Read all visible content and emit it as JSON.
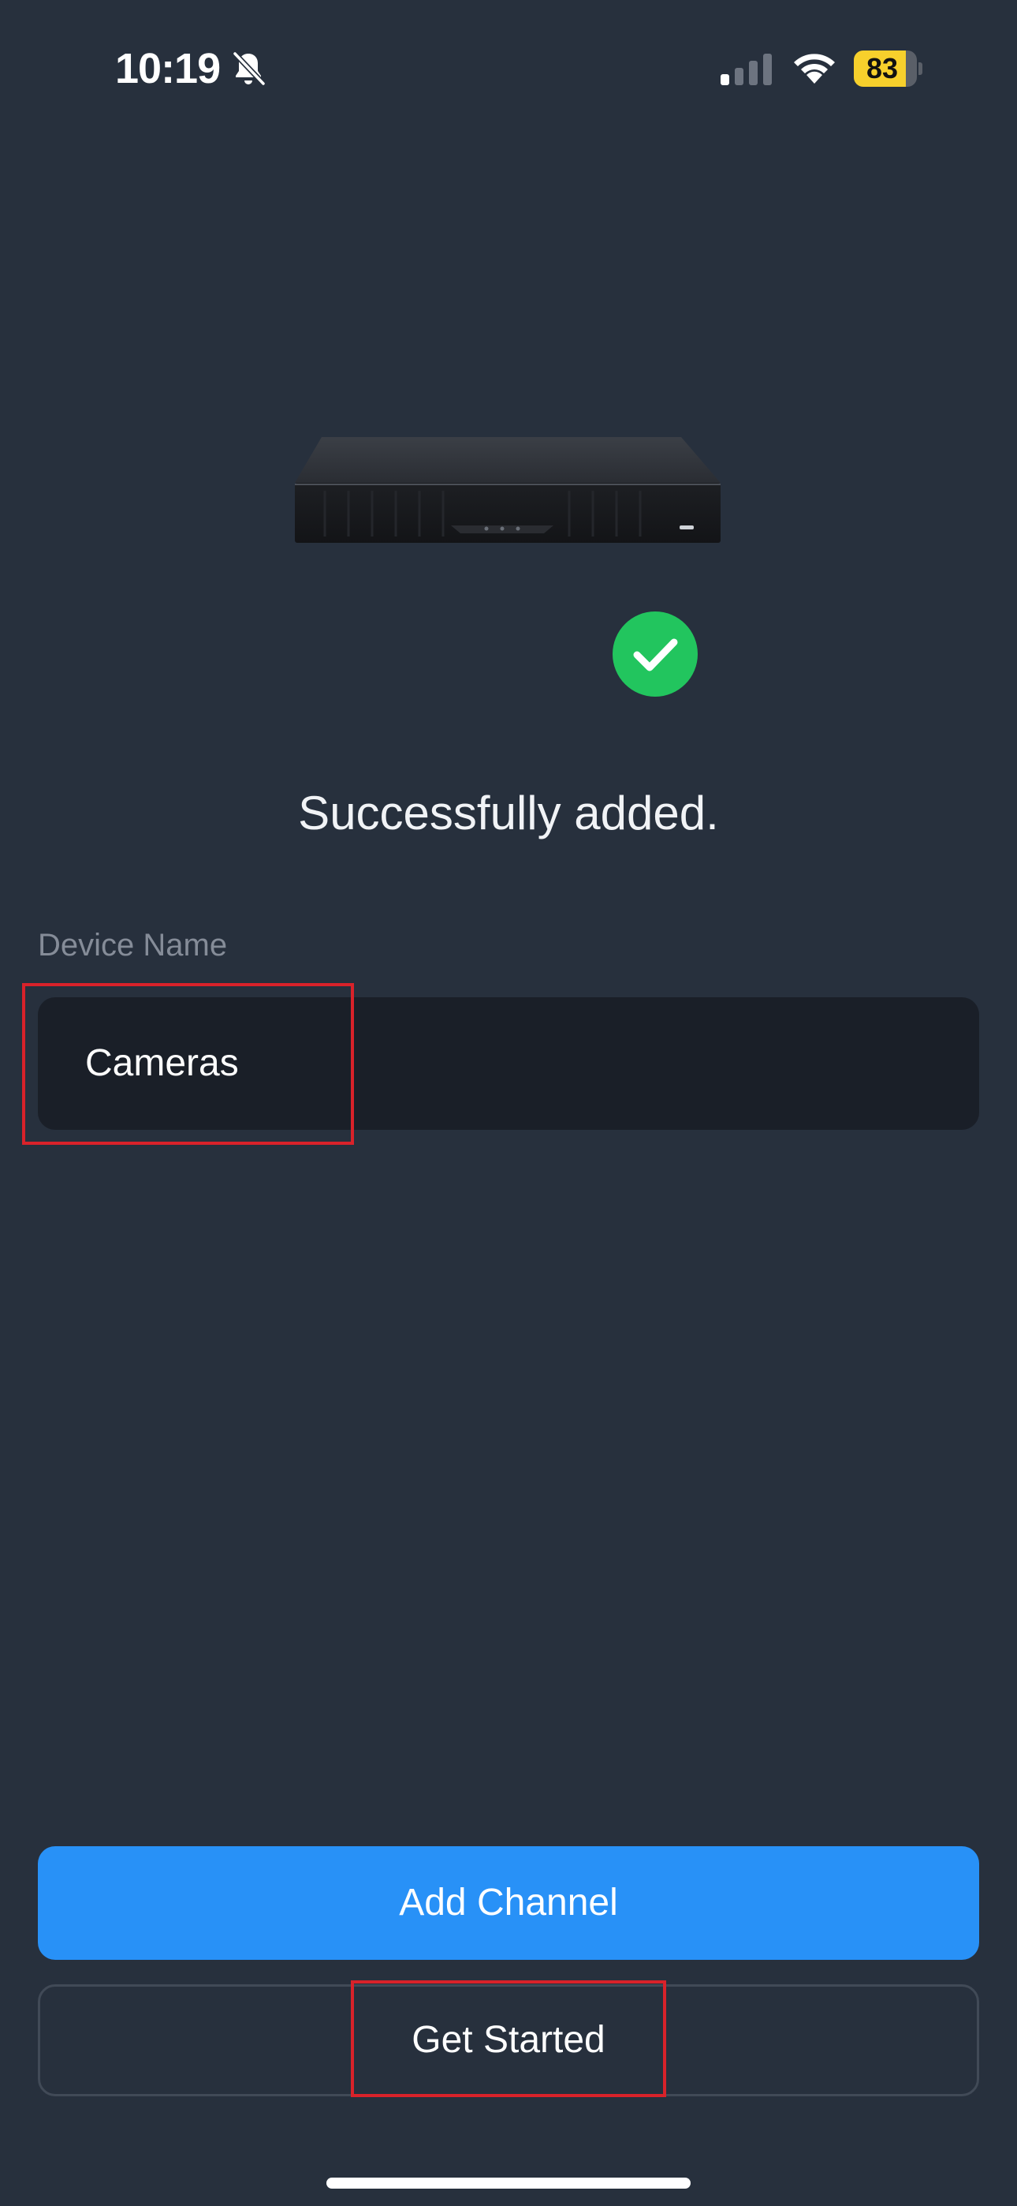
{
  "status_bar": {
    "time": "10:19",
    "battery_level": "83",
    "battery_fraction": 0.83,
    "icons": [
      "bell-slash-icon",
      "cellular-signal-icon",
      "wifi-icon",
      "battery-icon"
    ]
  },
  "main": {
    "device_image": "nvr-recorder-illustration",
    "success_icon": "check-circle-icon",
    "success_message": "Successfully added.",
    "device_name_label": "Device Name",
    "device_name_value": "Cameras"
  },
  "actions": {
    "add_channel_label": "Add Channel",
    "get_started_label": "Get Started"
  },
  "colors": {
    "background": "#27303d",
    "primary": "#2891f7",
    "success": "#22c55e",
    "input_bg": "#1a1f28",
    "annotation": "#d9222a",
    "battery": "#f7d02c"
  }
}
